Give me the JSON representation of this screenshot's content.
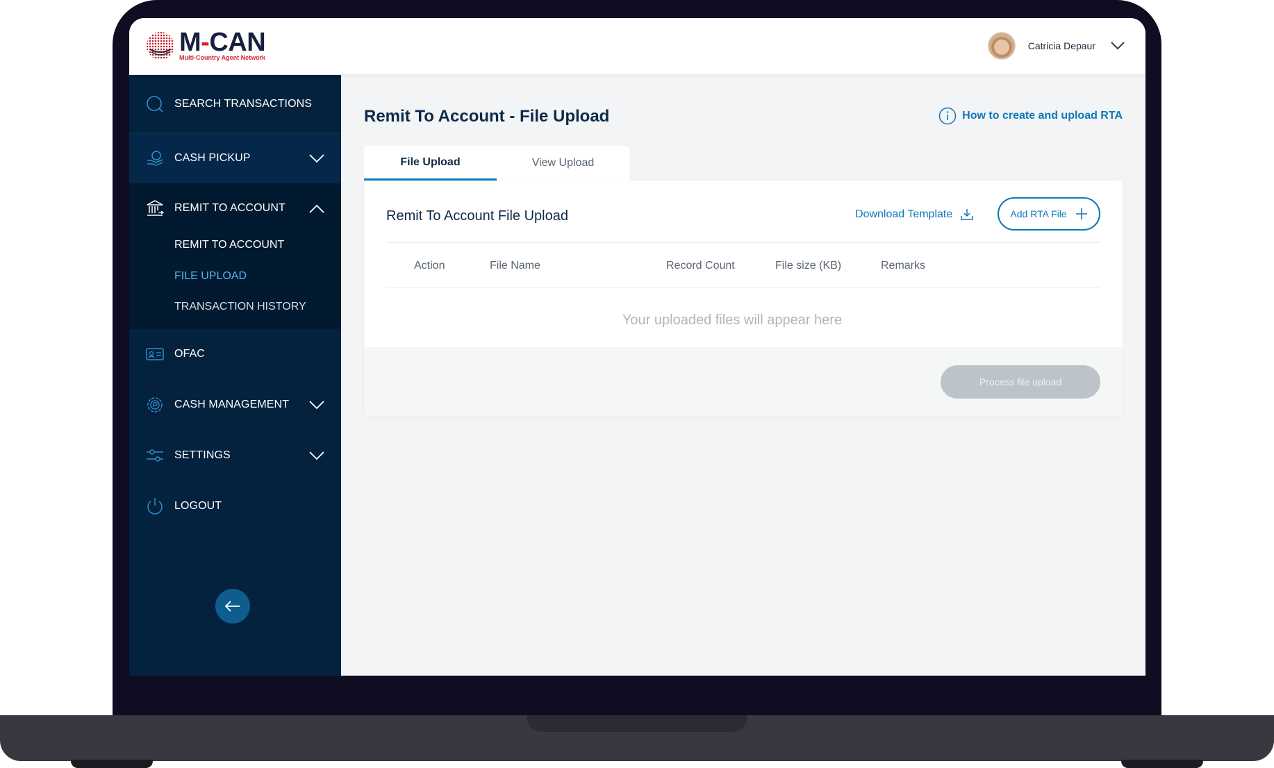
{
  "brand": {
    "name_part1": "M",
    "name_dash": "-",
    "name_part2": "CAN",
    "tagline": "Multi-Country Agent Network"
  },
  "user": {
    "name": "Catricia Depaur"
  },
  "sidebar": {
    "search": "SEARCH TRANSACTIONS",
    "cash_pickup": "CASH PICKUP",
    "remit": "REMIT TO ACCOUNT",
    "remit_sub": [
      "REMIT TO ACCOUNT",
      "FILE UPLOAD",
      "TRANSACTION HISTORY"
    ],
    "ofac": "OFAC",
    "cash_management": "CASH MANAGEMENT",
    "settings": "SETTINGS",
    "logout": "LOGOUT",
    "active_sub": "FILE UPLOAD"
  },
  "main": {
    "title": "Remit To Account - File Upload",
    "help_link": "How to create and upload RTA",
    "tabs": [
      {
        "label": "File Upload",
        "active": true
      },
      {
        "label": "View Upload",
        "active": false
      }
    ],
    "card": {
      "title": "Remit To Account File Upload",
      "download_label": "Download Template",
      "add_label": "Add RTA File",
      "columns": [
        "Action",
        "File Name",
        "Record Count",
        "File size (KB)",
        "Remarks"
      ],
      "empty_message": "Your uploaded files will appear here",
      "process_label": "Process file upload"
    }
  },
  "colors": {
    "sidebar_bg": "#04223d",
    "accent": "#1077b9",
    "active_sub": "#56b4ec",
    "brand_red": "#d22630"
  }
}
